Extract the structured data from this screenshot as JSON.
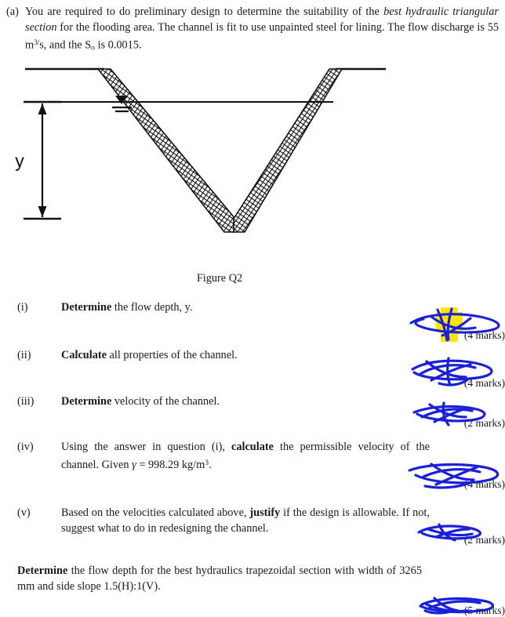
{
  "question": {
    "label": "(a)",
    "paragraph_part1": "You are required to do preliminary design to determine the suitability of the ",
    "paragraph_emph1": "best hydraulic triangular section",
    "paragraph_part2": " for the flooding area.  The channel is fit to use unpainted steel for lining.  The flow discharge is 55 m",
    "discharge_exponent": "3/",
    "paragraph_part3": "s, and the S",
    "slope_subscript": "o",
    "paragraph_part4": " is 0.0015."
  },
  "figure": {
    "caption": "Figure Q2",
    "depth_label": "y",
    "water_surface_symbol": "water-surface-triangle"
  },
  "items": [
    {
      "number": "(i)",
      "bold_lead": "Determine",
      "text": " the flow depth, y.",
      "marks": "(4 marks)"
    },
    {
      "number": "(ii)",
      "bold_lead": "Calculate",
      "text": " all properties of the channel.",
      "marks": "(4 marks)"
    },
    {
      "number": "(iii)",
      "bold_lead": "Determine",
      "text": " velocity of the channel.",
      "marks": "(2 marks)"
    },
    {
      "number": "(iv)",
      "text_before": "Using the answer in question (i), ",
      "bold_lead": "calculate",
      "text_after": " the permissible velocity of the channel.  Given ",
      "gamma": "γ",
      "gamma_value": " = 998.29 kg/m",
      "gamma_exponent": "3",
      "gamma_end": ".",
      "marks": "(4 marks)"
    },
    {
      "number": "(v)",
      "text_before": "Based on the velocities calculated above, ",
      "bold_lead": "justify",
      "text_after": " if the design is allowable. If not, suggest what to do in redesigning the channel.",
      "marks": "(2 marks)"
    }
  ],
  "final_question": {
    "bold_lead": "Determine",
    "text": " the flow depth for the best hydraulics trapezoidal section with width of 3265 mm and side slope 1.5(H):1(V).",
    "marks": "(5 marks)"
  },
  "annotations": {
    "ink_color": "#1a20d8",
    "highlight_color": "#ffe600",
    "description": "blue-pen-scribbles-over-marks"
  }
}
